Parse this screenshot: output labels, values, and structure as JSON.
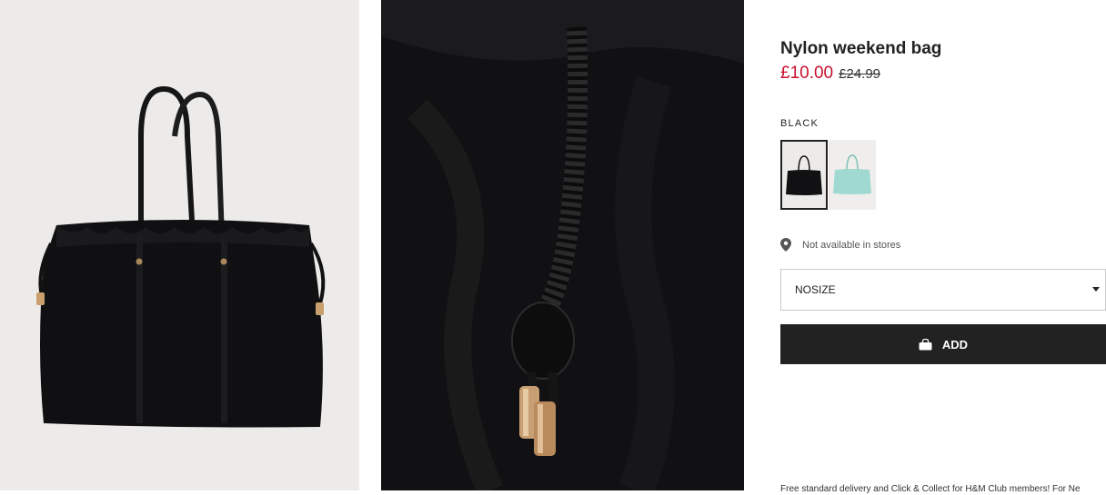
{
  "product": {
    "title": "Nylon weekend bag",
    "price_sale": "£10.00",
    "price_original": "£24.99",
    "color_selected": "BLACK",
    "swatches": [
      {
        "color": "black",
        "hex": "#0e0e10"
      },
      {
        "color": "mint",
        "hex": "#9fd9d1"
      }
    ],
    "store_availability": "Not available in stores",
    "size": {
      "selected": "NOSIZE"
    },
    "add_button_label": "ADD",
    "delivery_notice": "Free standard delivery and Click & Collect for H&M Club members! For Ne"
  },
  "icons": {
    "location": "location-pin-icon",
    "bag": "shopping-bag-icon",
    "caret": "chevron-down-icon"
  },
  "colors": {
    "sale_price": "#c8102e",
    "button_bg": "#222222",
    "selected_border": "#222222"
  }
}
